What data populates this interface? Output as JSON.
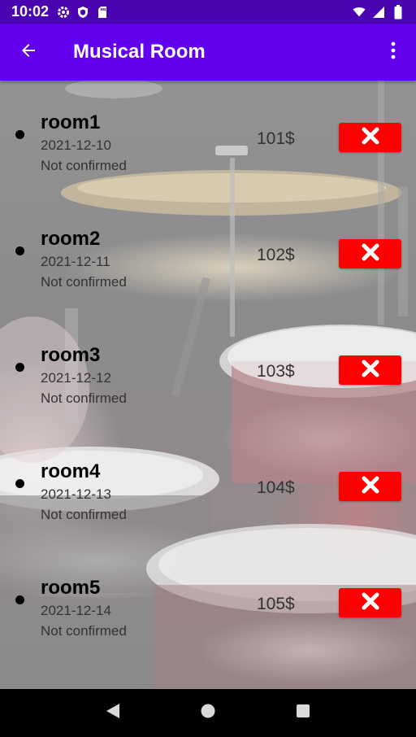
{
  "status_bar": {
    "time": "10:02",
    "left_icons": [
      "gear-icon",
      "shield-icon",
      "sd-card-icon"
    ],
    "right_icons": [
      "wifi-icon",
      "cell-signal-icon",
      "battery-icon"
    ]
  },
  "app_bar": {
    "title": "Musical Room",
    "back_icon": "arrow-back-icon",
    "menu_icon": "more-vert-icon",
    "color": "#6200ee"
  },
  "bookings": [
    {
      "name": "room1",
      "date": "2021-12-10",
      "status": "Not confirmed",
      "price": "101$"
    },
    {
      "name": "room2",
      "date": "2021-12-11",
      "status": "Not confirmed",
      "price": "102$"
    },
    {
      "name": "room3",
      "date": "2021-12-12",
      "status": "Not confirmed",
      "price": "103$"
    },
    {
      "name": "room4",
      "date": "2021-12-13",
      "status": "Not confirmed",
      "price": "104$"
    },
    {
      "name": "room5",
      "date": "2021-12-14",
      "status": "Not confirmed",
      "price": "105$"
    }
  ],
  "delete_button": {
    "icon": "close-icon",
    "color": "#ff0000"
  },
  "nav_bar": {
    "buttons": [
      "back-triangle-icon",
      "home-circle-icon",
      "recents-square-icon"
    ]
  }
}
